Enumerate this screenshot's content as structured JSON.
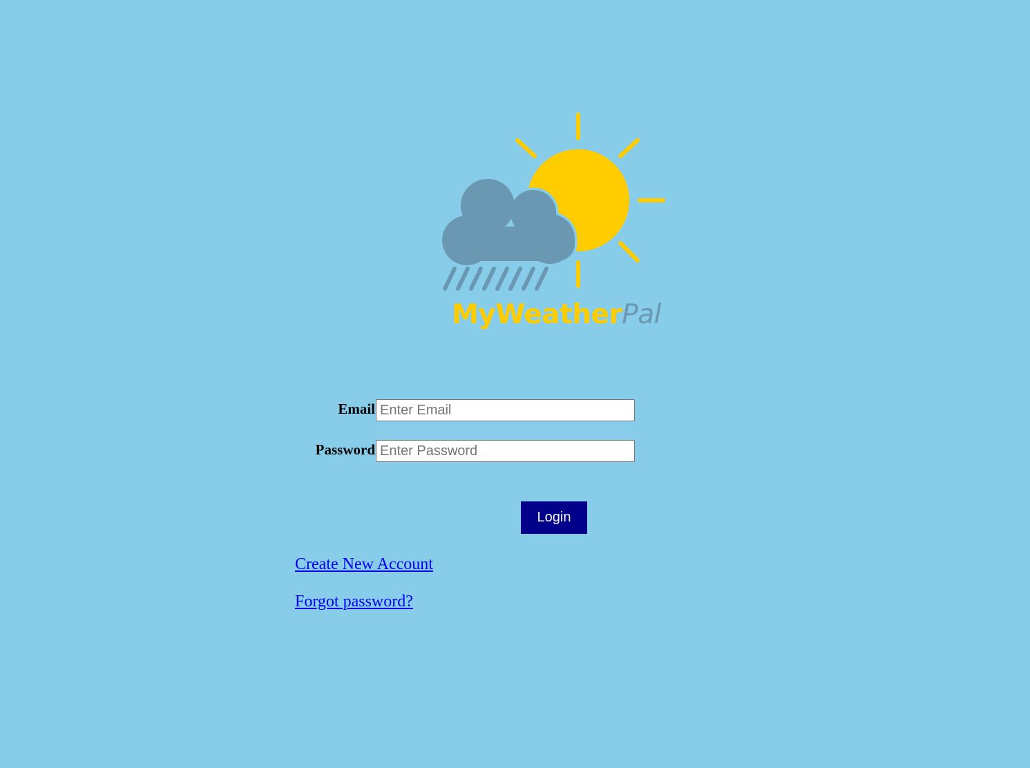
{
  "logo": {
    "text_part1": "MyWeather",
    "text_part2": "Pal"
  },
  "form": {
    "email_label": "Email",
    "email_placeholder": "Enter Email",
    "email_value": "",
    "password_label": "Password",
    "password_placeholder": "Enter Password",
    "password_value": ""
  },
  "actions": {
    "login_label": "Login",
    "create_account_label": "Create New Account",
    "forgot_password_label": "Forgot password?"
  },
  "colors": {
    "background": "#87CDEA",
    "sun": "#FFCC00",
    "cloud": "#6A98B2",
    "button": "#00008B",
    "link": "#0000EE"
  }
}
